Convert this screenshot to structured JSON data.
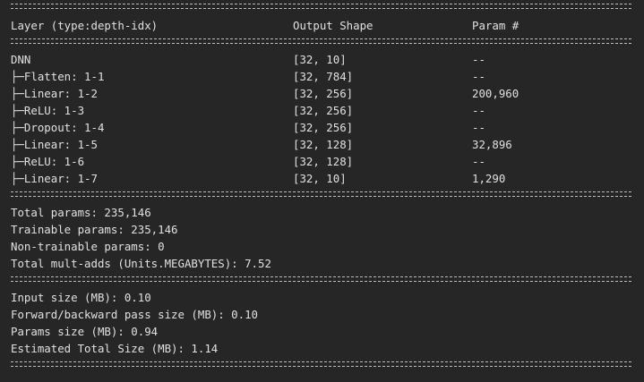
{
  "header": {
    "layer": "Layer (type:depth-idx)",
    "output_shape": "Output Shape",
    "params": "Param #"
  },
  "rows": [
    {
      "layer": "DNN",
      "shape": "[32, 10]",
      "params": "--"
    },
    {
      "layer": "├─Flatten: 1-1",
      "shape": "[32, 784]",
      "params": "--"
    },
    {
      "layer": "├─Linear: 1-2",
      "shape": "[32, 256]",
      "params": "200,960"
    },
    {
      "layer": "├─ReLU: 1-3",
      "shape": "[32, 256]",
      "params": "--"
    },
    {
      "layer": "├─Dropout: 1-4",
      "shape": "[32, 256]",
      "params": "--"
    },
    {
      "layer": "├─Linear: 1-5",
      "shape": "[32, 128]",
      "params": "32,896"
    },
    {
      "layer": "├─ReLU: 1-6",
      "shape": "[32, 128]",
      "params": "--"
    },
    {
      "layer": "├─Linear: 1-7",
      "shape": "[32, 10]",
      "params": "1,290"
    }
  ],
  "param_summary": [
    "Total params: 235,146",
    "Trainable params: 235,146",
    "Non-trainable params: 0",
    "Total mult-adds (Units.MEGABYTES): 7.52"
  ],
  "size_summary": [
    "Input size (MB): 0.10",
    "Forward/backward pass size (MB): 0.10",
    "Params size (MB): 0.94",
    "Estimated Total Size (MB): 1.14"
  ]
}
